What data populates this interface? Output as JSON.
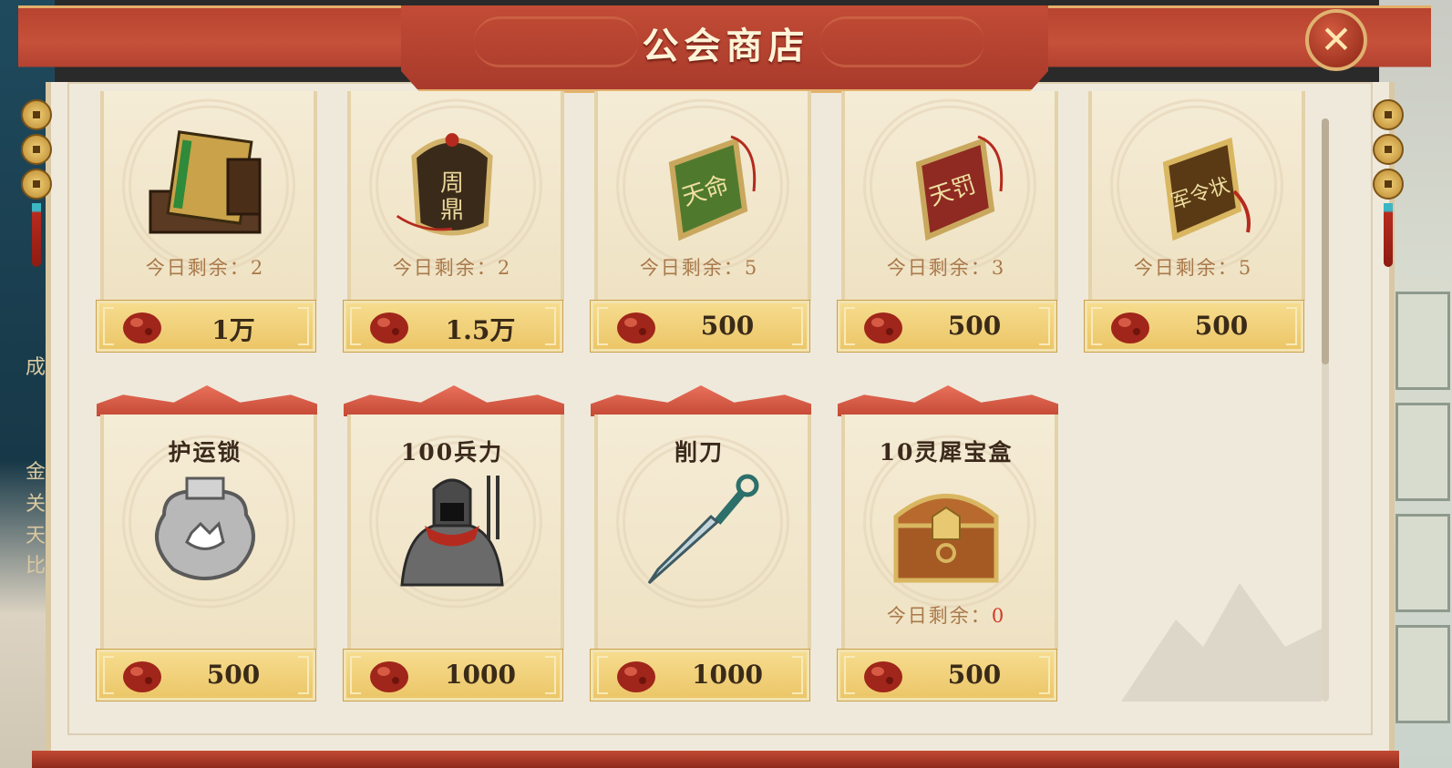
{
  "window": {
    "title": "公会商店",
    "close_icon": "close-icon"
  },
  "colors": {
    "header_red": "#b8432f",
    "gold": "#e3b06a",
    "price_bar": "#f2d27c",
    "remain_text": "#a9794a",
    "remain_zero": "#d23a2a"
  },
  "currency": {
    "icon": "red-gem-icon"
  },
  "remain_label": "今日剩余：",
  "items": [
    {
      "name": "",
      "remain": "2",
      "price": "1万",
      "icon": "book-chest-icon"
    },
    {
      "name": "",
      "remain": "2",
      "price": "1.5万",
      "icon": "bronze-tripod-token-icon"
    },
    {
      "name": "",
      "remain": "5",
      "price": "500",
      "icon": "green-tianming-token-icon"
    },
    {
      "name": "",
      "remain": "3",
      "price": "500",
      "icon": "red-tianfa-token-icon"
    },
    {
      "name": "",
      "remain": "5",
      "price": "500",
      "icon": "military-order-token-icon"
    },
    {
      "name": "护运锁",
      "remain": "",
      "price": "500",
      "icon": "silver-lock-icon"
    },
    {
      "name": "100兵力",
      "remain": "",
      "price": "1000",
      "icon": "armored-soldier-icon"
    },
    {
      "name": "削刀",
      "remain": "",
      "price": "1000",
      "icon": "knife-icon"
    },
    {
      "name": "10灵犀宝盒",
      "remain": "0",
      "price": "500",
      "icon": "treasure-chest-icon"
    }
  ],
  "left_side_text": [
    "成",
    "金",
    "关",
    "天",
    "比"
  ]
}
